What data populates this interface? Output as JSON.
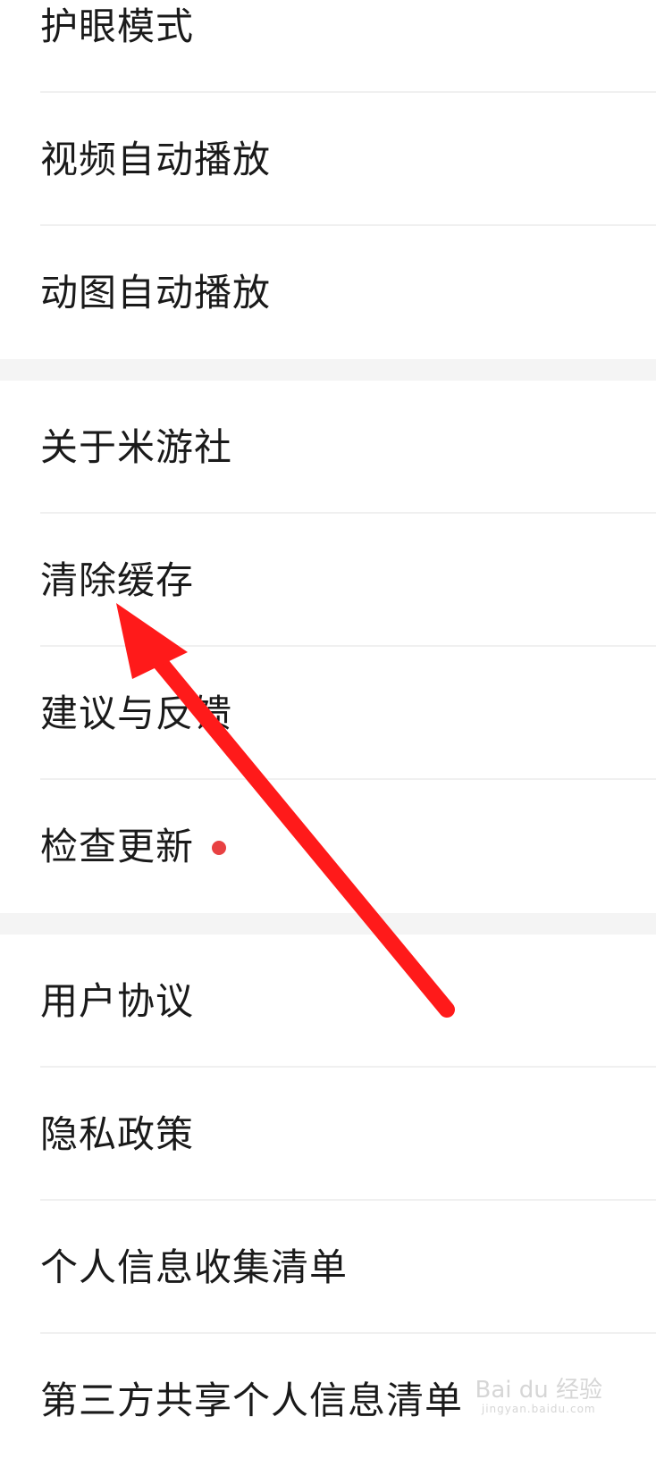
{
  "colors": {
    "badge": "#e84142",
    "arrow": "#ff1a1a",
    "separator": "#f4f4f4",
    "divider": "#f0f0f0"
  },
  "groups": [
    {
      "items": [
        {
          "label": "护眼模式"
        },
        {
          "label": "视频自动播放"
        },
        {
          "label": "动图自动播放"
        }
      ]
    },
    {
      "items": [
        {
          "label": "关于米游社"
        },
        {
          "label": "清除缓存"
        },
        {
          "label": "建议与反馈"
        },
        {
          "label": "检查更新",
          "badge": true
        }
      ]
    },
    {
      "items": [
        {
          "label": "用户协议"
        },
        {
          "label": "隐私政策"
        },
        {
          "label": "个人信息收集清单"
        },
        {
          "label": "第三方共享个人信息清单"
        }
      ]
    }
  ],
  "annotation": {
    "icon": "red-arrow-icon"
  },
  "watermark": {
    "text": "Bai du 经验",
    "subtext": "jingyan.baidu.com"
  }
}
